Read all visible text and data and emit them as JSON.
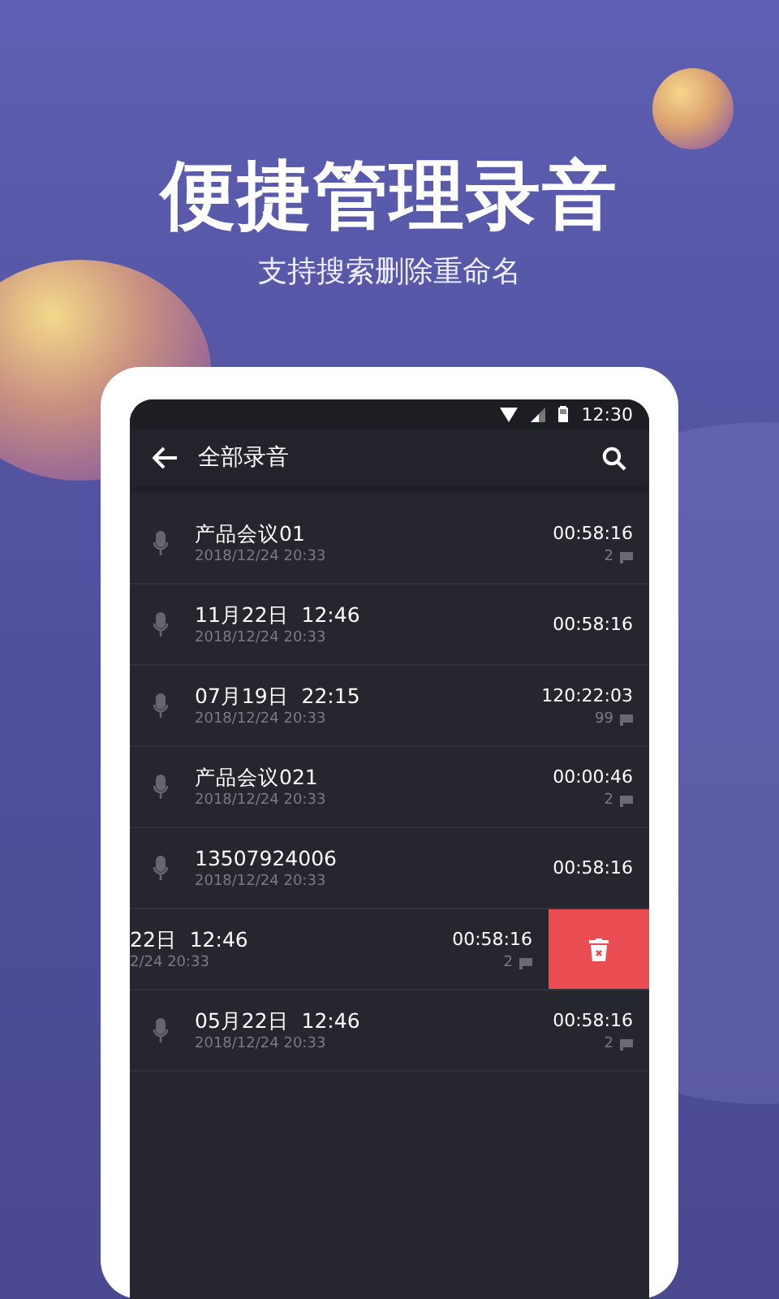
{
  "headline": "便捷管理录音",
  "subheadline": "支持搜索删除重命名",
  "status_bar": {
    "time": "12:30"
  },
  "app_bar": {
    "title": "全部录音"
  },
  "recordings": [
    {
      "kind": "normal",
      "title": "产品会议01",
      "date": "2018/12/24 20:33",
      "duration": "00:58:16",
      "marks": "2"
    },
    {
      "kind": "normal",
      "title": "11月22日  12:46",
      "date": "2018/12/24 20:33",
      "duration": "00:58:16"
    },
    {
      "kind": "normal",
      "title": "07月19日  22:15",
      "date": "2018/12/24 20:33",
      "duration": "120:22:03",
      "marks": "99"
    },
    {
      "kind": "normal",
      "title": "产品会议021",
      "date": "2018/12/24 20:33",
      "duration": "00:00:46",
      "marks": "2"
    },
    {
      "kind": "normal",
      "title": "13507924006",
      "date": "2018/12/24 20:33",
      "duration": "00:58:16"
    },
    {
      "kind": "swiped",
      "title": "22日  12:46",
      "date": "2/24 20:33",
      "duration": "00:58:16",
      "marks": "2"
    },
    {
      "kind": "normal",
      "title": "05月22日  12:46",
      "date": "2018/12/24 20:33",
      "duration": "00:58:16",
      "marks": "2"
    }
  ]
}
